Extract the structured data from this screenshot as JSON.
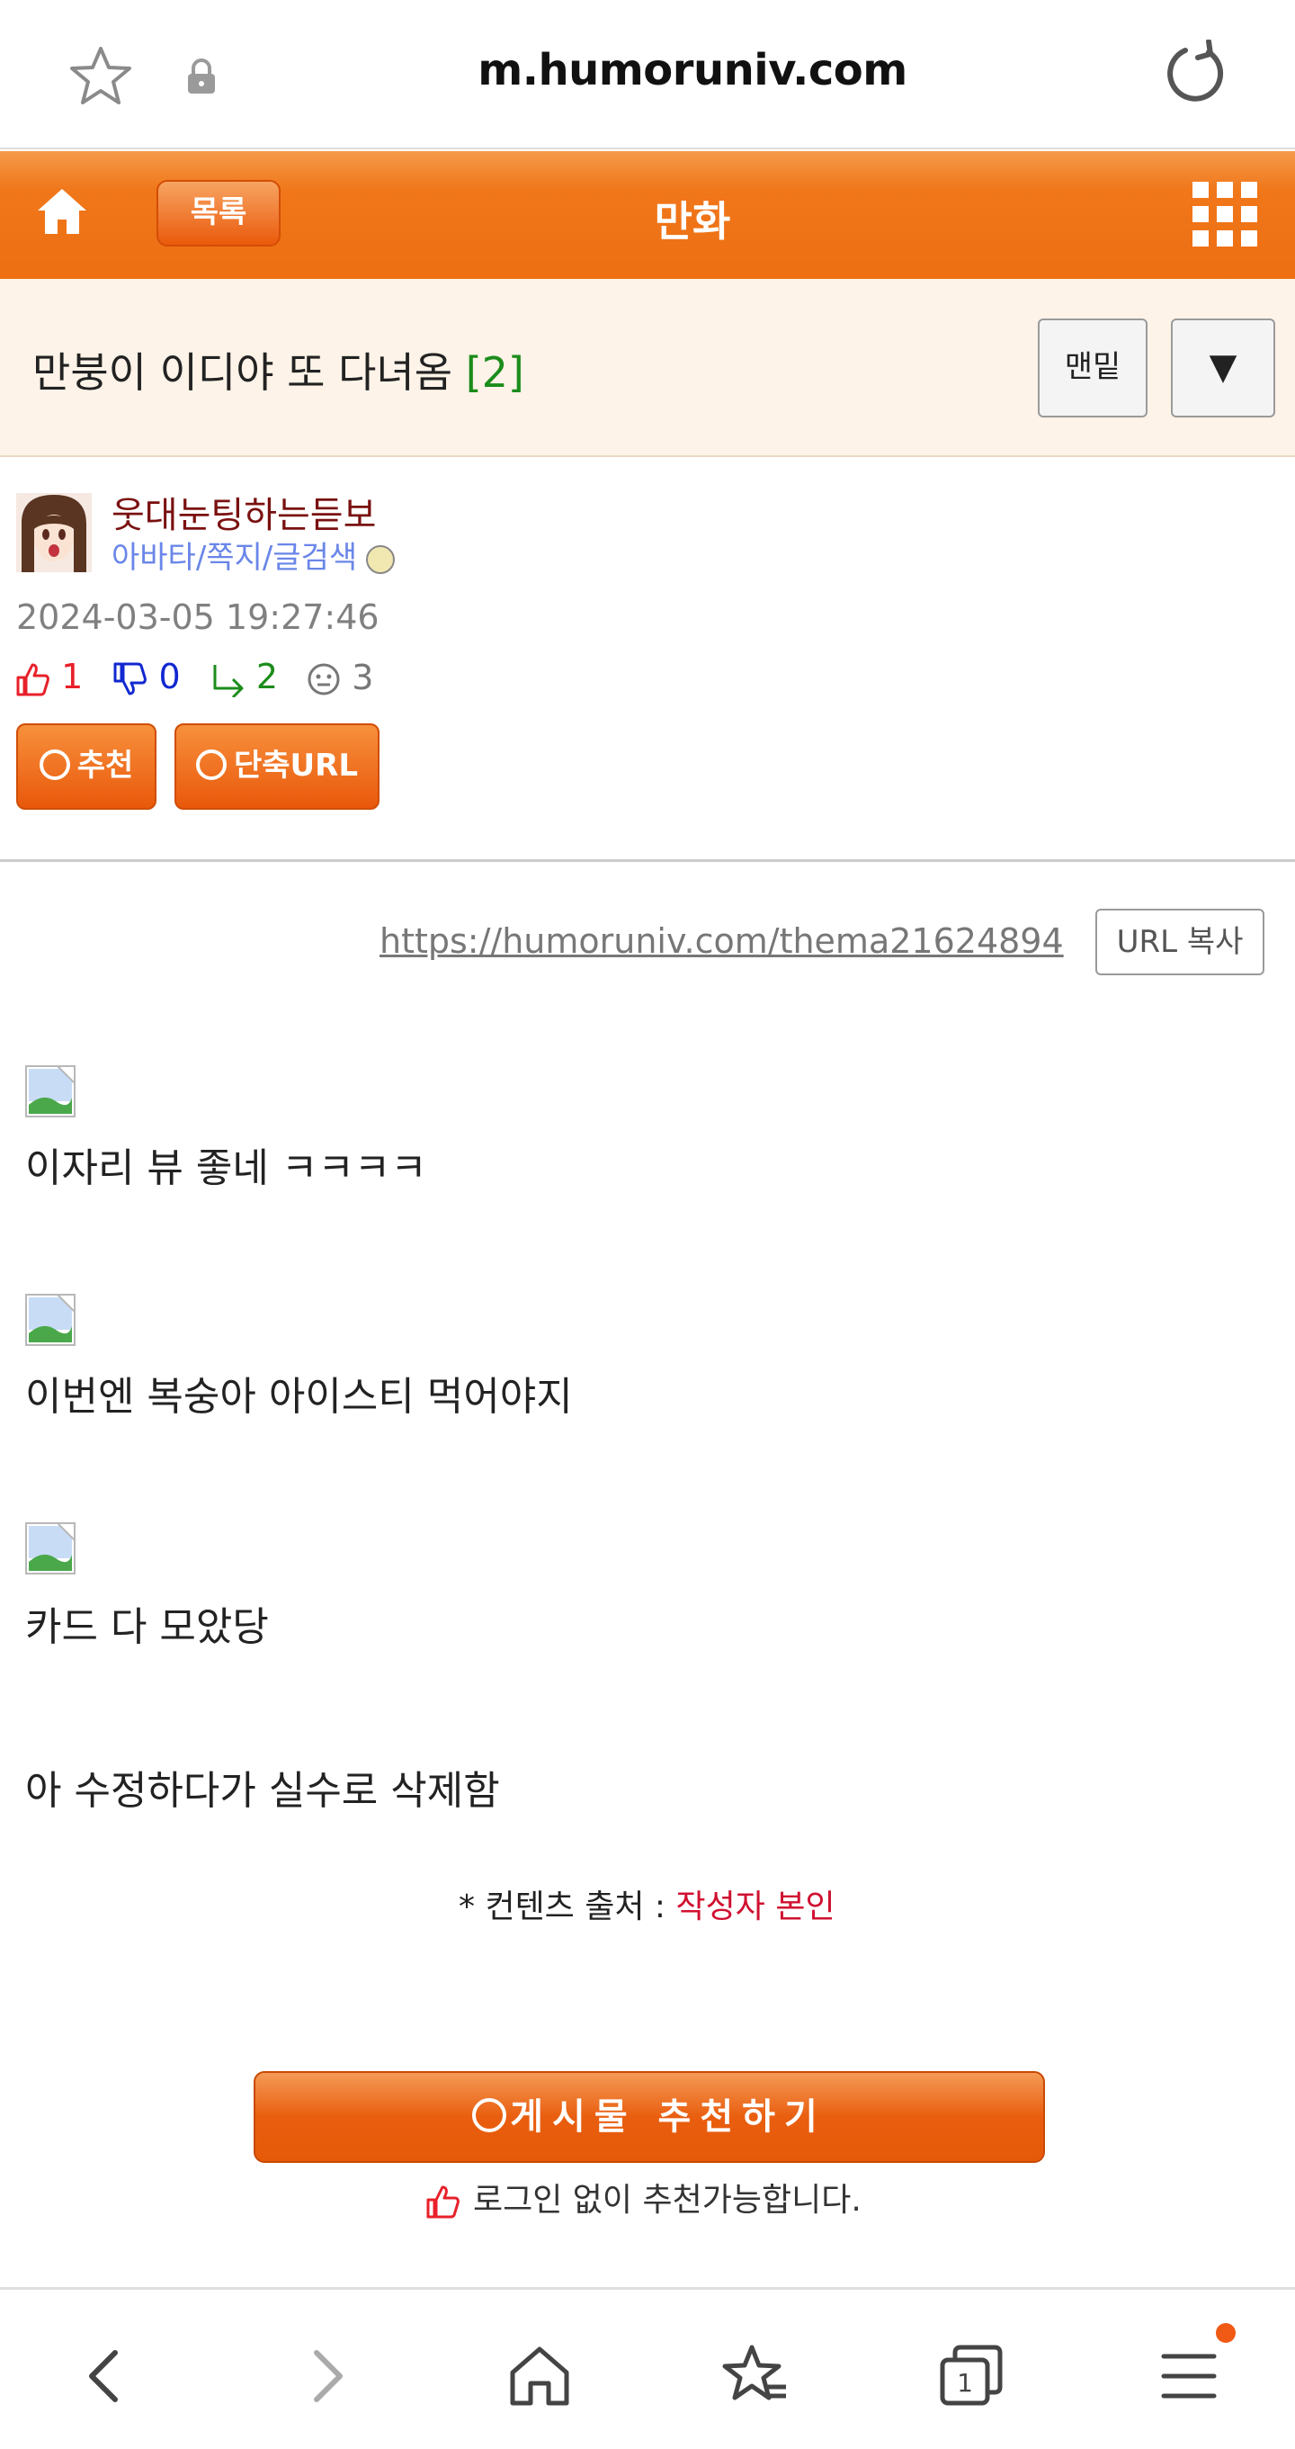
{
  "browser": {
    "domain": "m.humoruniv.com"
  },
  "header": {
    "list_label": "목록",
    "board_title": "만화"
  },
  "post": {
    "title": "만붕이 이디야 또 다녀옴",
    "comment_count": "[2]",
    "bottom_label": "맨밑",
    "down_label": "▼",
    "author": {
      "nickname": "웃대눈팅하는듣보",
      "links": "아바타/쪽지/글검색",
      "date": "2024-03-05 19:27:46"
    },
    "stats": {
      "up": "1",
      "down": "0",
      "replies": "2",
      "views": "3"
    },
    "buttons": {
      "recommend": "추천",
      "short_url": "단축URL"
    },
    "short_url": "https://humoruniv.com/thema21624894",
    "copy_label": "URL 복사",
    "lines": [
      "이자리 뷰 좋네 ㅋㅋㅋㅋ",
      "이번엔 복숭아 아이스티 먹어야지",
      "카드 다 모았당",
      "아 수정하다가 실수로 삭제함"
    ],
    "source_label": "* 컨텐츠 출처 :",
    "source_value": "작성자 본인",
    "recommend_big": "게시물 추천하기",
    "nologin_note": "로그인 없이 추천가능합니다."
  },
  "colors": {
    "accent": "#ed6f12",
    "title_bg": "#fdf3e8",
    "nickname": "#7a1010",
    "link": "#6a86e8",
    "up": "#e8202a",
    "down": "#1228d0",
    "reply": "#1b8c1b",
    "source": "#d01030"
  },
  "icons": {
    "url_bar": [
      "star-icon",
      "lock-icon",
      "reload-icon"
    ],
    "header": [
      "home-icon",
      "grid-menu-icon"
    ],
    "toolbar": [
      "back-icon",
      "forward-icon",
      "home-icon",
      "bookmarks-icon",
      "tabs-icon",
      "menu-icon"
    ]
  },
  "toolbar": {
    "tab_count": "1"
  }
}
